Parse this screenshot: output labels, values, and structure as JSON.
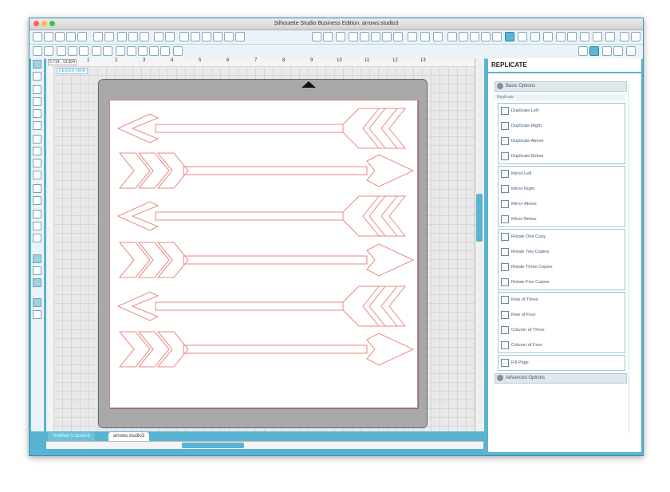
{
  "window": {
    "title": "Silhouette Studio Business Edition: arrows.studio3"
  },
  "ruler": {
    "coords": "5.714 , 13.604",
    "ticks": [
      "1",
      "2",
      "3",
      "4",
      "5",
      "6",
      "7",
      "8",
      "9",
      "10",
      "11",
      "12",
      "13"
    ]
  },
  "canvas": {
    "design_view_label": "DESIGN VIEW"
  },
  "tabs": [
    {
      "label": "Untitled-1.studio3"
    },
    {
      "label": "arrows.studio3"
    }
  ],
  "panel": {
    "title": "REPLICATE",
    "basic_options": "Basic Options",
    "replicate_label": "Replicate",
    "advanced_options": "Advanced Options",
    "groups": [
      {
        "options": [
          {
            "label": "Duplicate Left",
            "icon": "duplicate-left-icon"
          },
          {
            "label": "Duplicate Right",
            "icon": "duplicate-right-icon"
          },
          {
            "label": "Duplicate Above",
            "icon": "duplicate-above-icon"
          },
          {
            "label": "Duplicate Below",
            "icon": "duplicate-below-icon"
          }
        ]
      },
      {
        "options": [
          {
            "label": "Mirror Left",
            "icon": "mirror-left-icon"
          },
          {
            "label": "Mirror Right",
            "icon": "mirror-right-icon"
          },
          {
            "label": "Mirror Above",
            "icon": "mirror-above-icon"
          },
          {
            "label": "Mirror Below",
            "icon": "mirror-below-icon"
          }
        ]
      },
      {
        "options": [
          {
            "label": "Rotate One Copy",
            "icon": "rotate-one-icon"
          },
          {
            "label": "Rotate Two Copies",
            "icon": "rotate-two-icon"
          },
          {
            "label": "Rotate Three Copies",
            "icon": "rotate-three-icon"
          },
          {
            "label": "Rotate Five Copies",
            "icon": "rotate-five-icon"
          }
        ]
      },
      {
        "options": [
          {
            "label": "Row of Three",
            "icon": "row-three-icon"
          },
          {
            "label": "Row of Four",
            "icon": "row-four-icon"
          },
          {
            "label": "Column of Three",
            "icon": "column-three-icon"
          },
          {
            "label": "Column of Four",
            "icon": "column-four-icon"
          }
        ]
      },
      {
        "options": [
          {
            "label": "Fill Page",
            "icon": "fill-page-icon"
          }
        ]
      }
    ]
  },
  "colors": {
    "accent": "#58b4d2",
    "cut_line": "#e88a82",
    "panel_text": "#3d5d7a"
  }
}
